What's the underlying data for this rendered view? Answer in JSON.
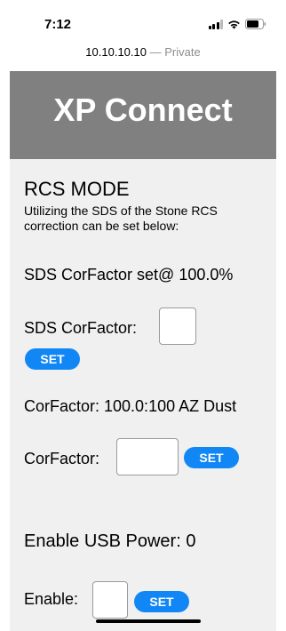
{
  "status_bar": {
    "time": "7:12"
  },
  "url_bar": {
    "host": "10.10.10.10",
    "separator": " — ",
    "privacy": "Private"
  },
  "header": {
    "title": "XP Connect"
  },
  "rcs": {
    "title": "RCS MODE",
    "description": "Utilizing the SDS of the Stone RCS correction can be set below:",
    "sds_status": "SDS CorFactor set@ 100.0%",
    "sds_label": "SDS CorFactor:",
    "sds_input_value": "",
    "sds_set_label": "SET"
  },
  "corfactor": {
    "status": "CorFactor: 100.0:100 AZ Dust",
    "label": "CorFactor:",
    "input_value": "",
    "set_label": "SET"
  },
  "usb": {
    "status": "Enable USB Power: 0",
    "enable_label": "Enable:",
    "enable_input_value": "",
    "set_label": "SET"
  },
  "colors": {
    "header_bg": "#808080",
    "page_bg": "#f0f0f0",
    "button_blue": "#1187f5"
  },
  "icons": [
    "cellular-signal-icon",
    "wifi-icon",
    "battery-icon"
  ]
}
